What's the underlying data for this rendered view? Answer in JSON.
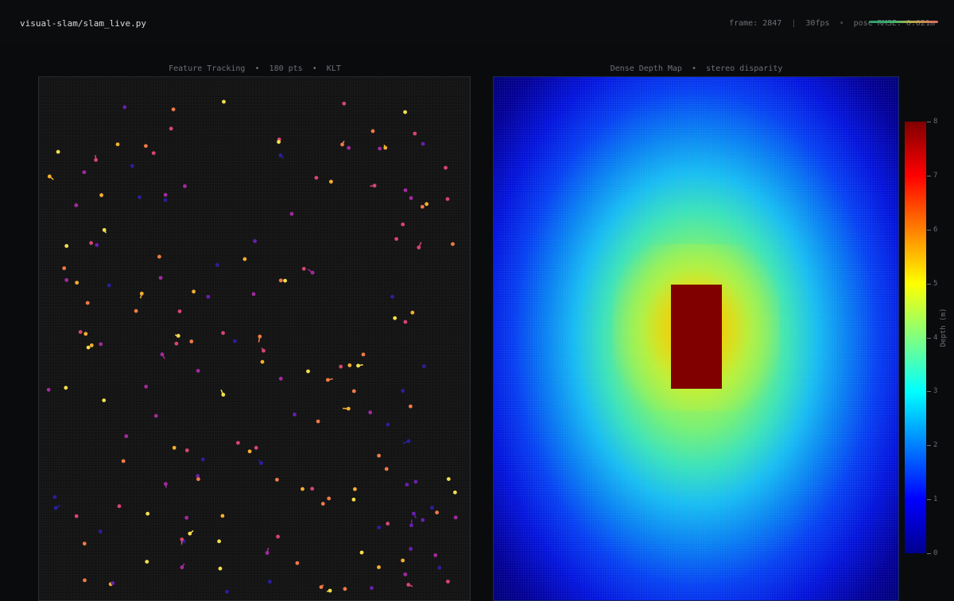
{
  "header": {
    "script_path": "visual-slam/slam_live.py",
    "frame": "frame: 2847",
    "fps": "30fps",
    "pose_rmse": "pose RMSE: 0.021m",
    "sep1": "|",
    "sep2": "•"
  },
  "tracking_panel": {
    "title": "Feature Tracking  •  180 pts  •  KLT"
  },
  "depth_panel": {
    "title": "Dense Depth Map  •  stereo disparity"
  },
  "colorbar": {
    "label": "Depth (m)",
    "ticks": [
      "8",
      "7",
      "6",
      "5",
      "4",
      "3",
      "2",
      "1",
      "0"
    ],
    "range": [
      0,
      8
    ]
  },
  "colors": {
    "background": "#0a0b0d",
    "text_dim": "#6c7076",
    "title_text": "#d8dadc",
    "feature_palette": [
      "#2a1f9e",
      "#6a1fb0",
      "#a32a9e",
      "#d9456f",
      "#f07a45",
      "#f5b02e",
      "#f4e04a"
    ]
  }
}
